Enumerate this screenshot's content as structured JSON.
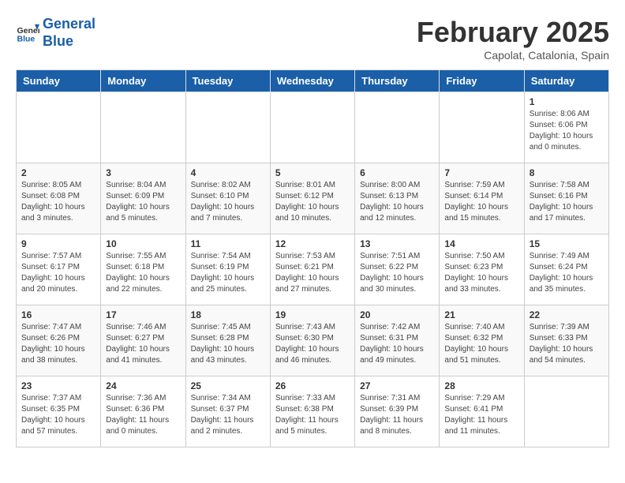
{
  "header": {
    "logo_line1": "General",
    "logo_line2": "Blue",
    "month_title": "February 2025",
    "location": "Capolat, Catalonia, Spain"
  },
  "days_of_week": [
    "Sunday",
    "Monday",
    "Tuesday",
    "Wednesday",
    "Thursday",
    "Friday",
    "Saturday"
  ],
  "weeks": [
    [
      {
        "day": "",
        "info": ""
      },
      {
        "day": "",
        "info": ""
      },
      {
        "day": "",
        "info": ""
      },
      {
        "day": "",
        "info": ""
      },
      {
        "day": "",
        "info": ""
      },
      {
        "day": "",
        "info": ""
      },
      {
        "day": "1",
        "info": "Sunrise: 8:06 AM\nSunset: 6:06 PM\nDaylight: 10 hours\nand 0 minutes."
      }
    ],
    [
      {
        "day": "2",
        "info": "Sunrise: 8:05 AM\nSunset: 6:08 PM\nDaylight: 10 hours\nand 3 minutes."
      },
      {
        "day": "3",
        "info": "Sunrise: 8:04 AM\nSunset: 6:09 PM\nDaylight: 10 hours\nand 5 minutes."
      },
      {
        "day": "4",
        "info": "Sunrise: 8:02 AM\nSunset: 6:10 PM\nDaylight: 10 hours\nand 7 minutes."
      },
      {
        "day": "5",
        "info": "Sunrise: 8:01 AM\nSunset: 6:12 PM\nDaylight: 10 hours\nand 10 minutes."
      },
      {
        "day": "6",
        "info": "Sunrise: 8:00 AM\nSunset: 6:13 PM\nDaylight: 10 hours\nand 12 minutes."
      },
      {
        "day": "7",
        "info": "Sunrise: 7:59 AM\nSunset: 6:14 PM\nDaylight: 10 hours\nand 15 minutes."
      },
      {
        "day": "8",
        "info": "Sunrise: 7:58 AM\nSunset: 6:16 PM\nDaylight: 10 hours\nand 17 minutes."
      }
    ],
    [
      {
        "day": "9",
        "info": "Sunrise: 7:57 AM\nSunset: 6:17 PM\nDaylight: 10 hours\nand 20 minutes."
      },
      {
        "day": "10",
        "info": "Sunrise: 7:55 AM\nSunset: 6:18 PM\nDaylight: 10 hours\nand 22 minutes."
      },
      {
        "day": "11",
        "info": "Sunrise: 7:54 AM\nSunset: 6:19 PM\nDaylight: 10 hours\nand 25 minutes."
      },
      {
        "day": "12",
        "info": "Sunrise: 7:53 AM\nSunset: 6:21 PM\nDaylight: 10 hours\nand 27 minutes."
      },
      {
        "day": "13",
        "info": "Sunrise: 7:51 AM\nSunset: 6:22 PM\nDaylight: 10 hours\nand 30 minutes."
      },
      {
        "day": "14",
        "info": "Sunrise: 7:50 AM\nSunset: 6:23 PM\nDaylight: 10 hours\nand 33 minutes."
      },
      {
        "day": "15",
        "info": "Sunrise: 7:49 AM\nSunset: 6:24 PM\nDaylight: 10 hours\nand 35 minutes."
      }
    ],
    [
      {
        "day": "16",
        "info": "Sunrise: 7:47 AM\nSunset: 6:26 PM\nDaylight: 10 hours\nand 38 minutes."
      },
      {
        "day": "17",
        "info": "Sunrise: 7:46 AM\nSunset: 6:27 PM\nDaylight: 10 hours\nand 41 minutes."
      },
      {
        "day": "18",
        "info": "Sunrise: 7:45 AM\nSunset: 6:28 PM\nDaylight: 10 hours\nand 43 minutes."
      },
      {
        "day": "19",
        "info": "Sunrise: 7:43 AM\nSunset: 6:30 PM\nDaylight: 10 hours\nand 46 minutes."
      },
      {
        "day": "20",
        "info": "Sunrise: 7:42 AM\nSunset: 6:31 PM\nDaylight: 10 hours\nand 49 minutes."
      },
      {
        "day": "21",
        "info": "Sunrise: 7:40 AM\nSunset: 6:32 PM\nDaylight: 10 hours\nand 51 minutes."
      },
      {
        "day": "22",
        "info": "Sunrise: 7:39 AM\nSunset: 6:33 PM\nDaylight: 10 hours\nand 54 minutes."
      }
    ],
    [
      {
        "day": "23",
        "info": "Sunrise: 7:37 AM\nSunset: 6:35 PM\nDaylight: 10 hours\nand 57 minutes."
      },
      {
        "day": "24",
        "info": "Sunrise: 7:36 AM\nSunset: 6:36 PM\nDaylight: 11 hours\nand 0 minutes."
      },
      {
        "day": "25",
        "info": "Sunrise: 7:34 AM\nSunset: 6:37 PM\nDaylight: 11 hours\nand 2 minutes."
      },
      {
        "day": "26",
        "info": "Sunrise: 7:33 AM\nSunset: 6:38 PM\nDaylight: 11 hours\nand 5 minutes."
      },
      {
        "day": "27",
        "info": "Sunrise: 7:31 AM\nSunset: 6:39 PM\nDaylight: 11 hours\nand 8 minutes."
      },
      {
        "day": "28",
        "info": "Sunrise: 7:29 AM\nSunset: 6:41 PM\nDaylight: 11 hours\nand 11 minutes."
      },
      {
        "day": "",
        "info": ""
      }
    ]
  ]
}
